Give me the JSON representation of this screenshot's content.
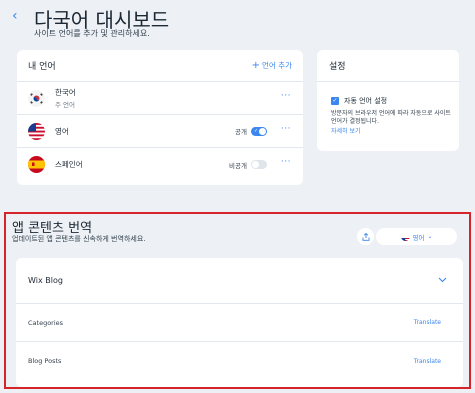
{
  "header": {
    "back_icon": "chevron-left-icon",
    "title": "다국어 대시보드",
    "subtitle": "사이트 언어를 추가 및 관리하세요."
  },
  "languages_card": {
    "title": "내 언어",
    "add_label": "언어 추가",
    "add_icon": "plus-icon",
    "items": [
      {
        "name": "한국어",
        "sub": "주 언어",
        "flag": "south-korea-flag-icon",
        "status": "",
        "toggle": null
      },
      {
        "name": "영어",
        "sub": "",
        "flag": "usa-flag-icon",
        "status": "공개",
        "toggle": true
      },
      {
        "name": "스페인어",
        "sub": "",
        "flag": "spain-flag-icon",
        "status": "비공개",
        "toggle": false
      }
    ],
    "more_label": "···"
  },
  "settings_card": {
    "title": "설정",
    "checkbox_label": "자동 언어 설정",
    "checked": true,
    "description": "방문자의 브라우저 언어에 따라 자동으로 사이트 언어가 결정됩니다.",
    "link": "자세히 보기"
  },
  "app_section": {
    "title": "앱 콘텐츠 번역",
    "subtitle": "업데이트된 앱 콘텐츠를 신속하게 번역하세요.",
    "share_icon": "share-icon",
    "selected_language": "영어",
    "blog": {
      "title": "Wix Blog",
      "rows": [
        {
          "name": "Categories",
          "action": "Translate"
        },
        {
          "name": "Blog Posts",
          "action": "Translate"
        }
      ]
    }
  },
  "colors": {
    "accent": "#3b86f0",
    "background": "#edf1f5",
    "highlight_border": "#d5252b"
  }
}
